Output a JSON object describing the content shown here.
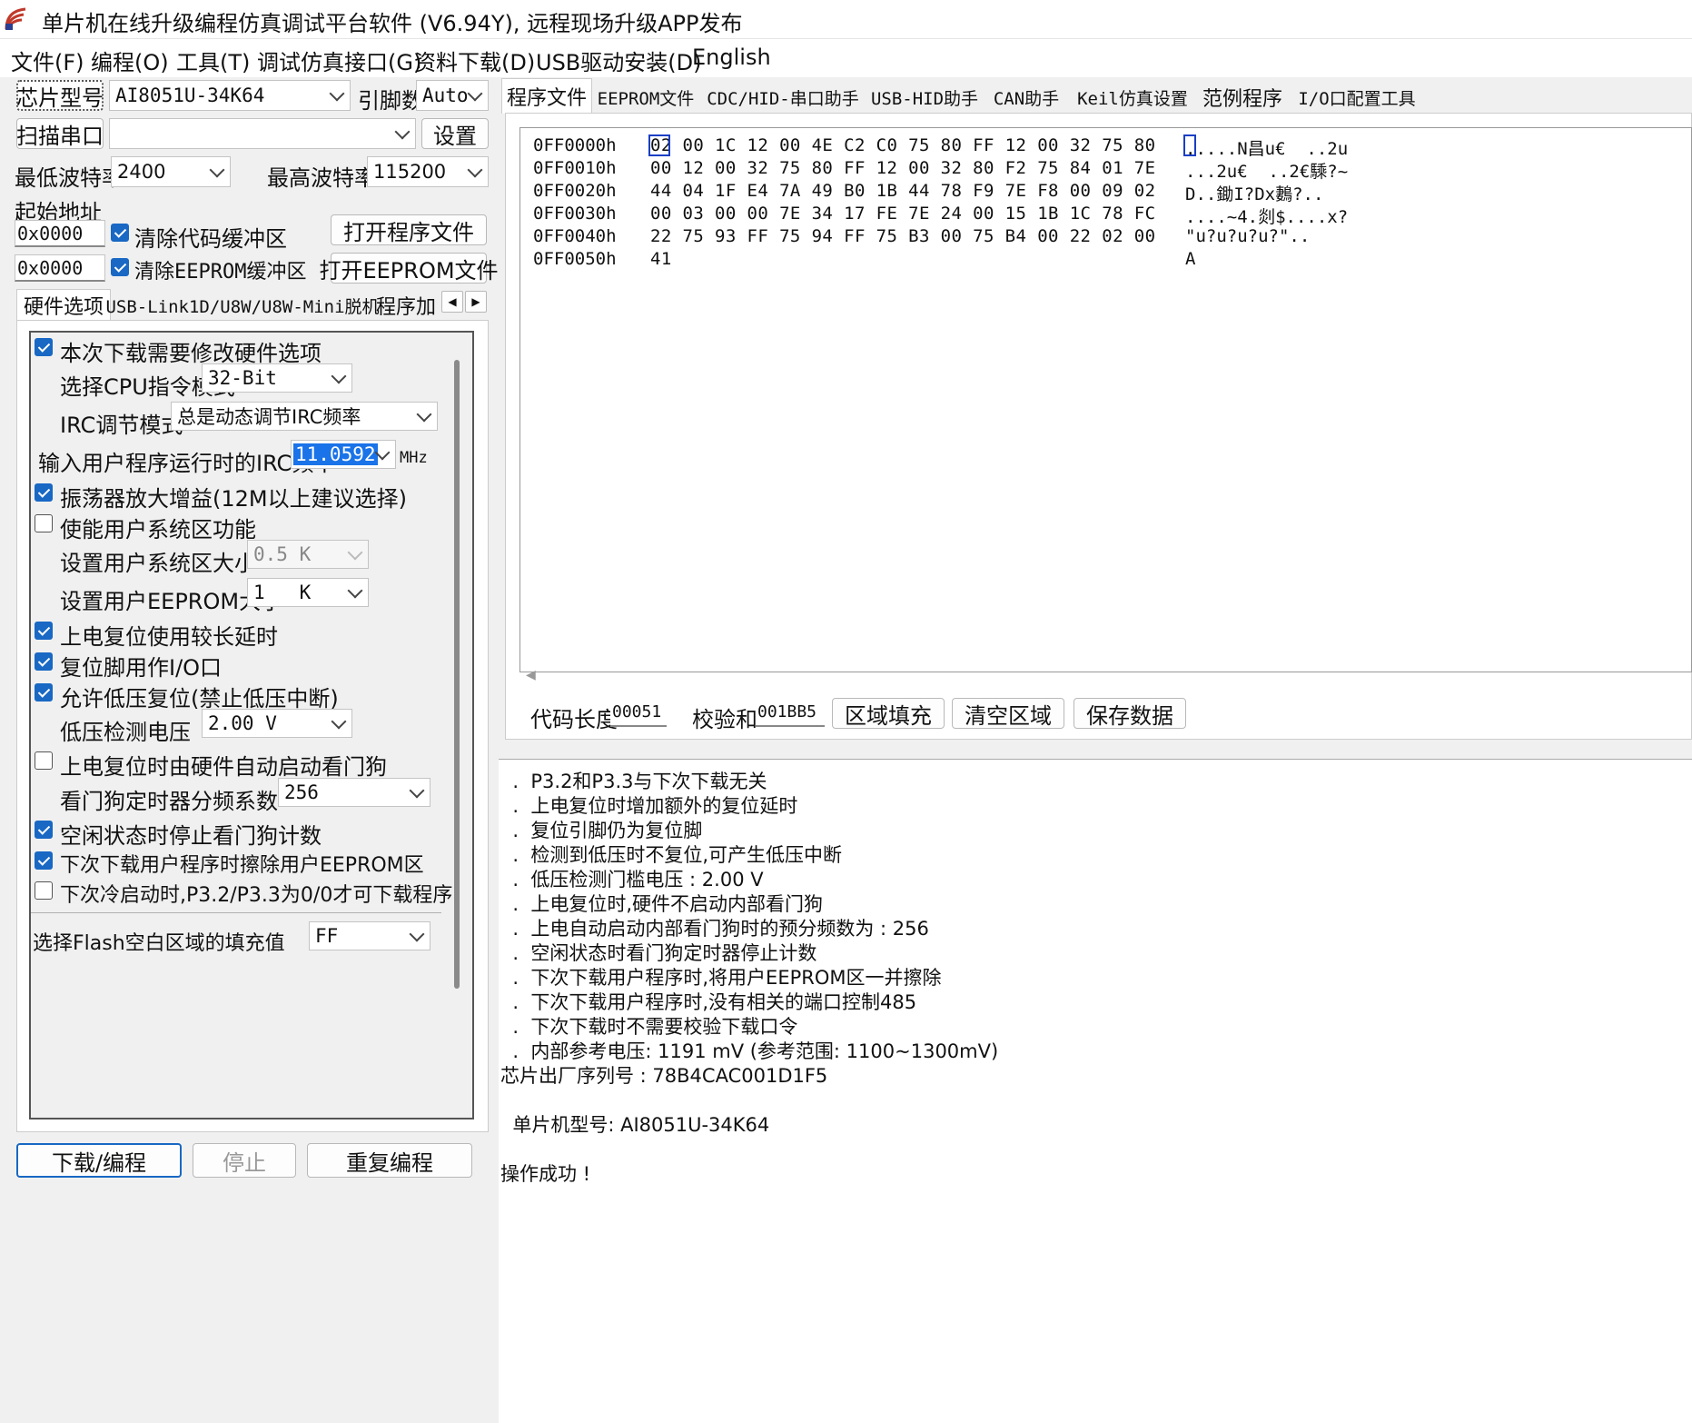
{
  "window": {
    "title": "单片机在线升级编程仿真调试平台软件 (V6.94Y), 远程现场升级APP发布"
  },
  "menu": [
    "文件(F)",
    "编程(O)",
    "工具(T)",
    "调试仿真接口(G)",
    "资料下载(D)",
    "USB驱动安装(D)",
    "English"
  ],
  "left": {
    "chip_model_button": "芯片型号",
    "chip_model_value": "AI8051U-34K64",
    "pin_count_label": "引脚数",
    "pin_count_value": "Auto",
    "scan_port_button": "扫描串口",
    "port_value": "",
    "settings_button": "设置",
    "min_baud_label": "最低波特率",
    "min_baud_value": "2400",
    "max_baud_label": "最高波特率",
    "max_baud_value": "115200",
    "start_addr_label": "起始地址",
    "code_addr": "0x0000",
    "clear_code_label": "清除代码缓冲区",
    "open_program_button": "打开程序文件",
    "eeprom_addr": "0x0000",
    "clear_eeprom_label": "清除EEPROM缓冲区",
    "open_eeprom_button": "打开EEPROM文件",
    "tabs": [
      "硬件选项",
      "USB-Link1D/U8W/U8W-Mini脱机",
      "程序加"
    ],
    "options": {
      "modify_hw": "本次下载需要修改硬件选项",
      "cpu_mode_label": "选择CPU指令模式",
      "cpu_mode_value": "32-Bit",
      "irc_mode_label": "IRC调节模式",
      "irc_mode_value": "总是动态调节IRC频率",
      "irc_freq_label": "输入用户程序运行时的IRC频率",
      "irc_freq_value": "11.0592",
      "irc_freq_unit": "MHz",
      "osc_gain": "振荡器放大增益(12M以上建议选择)",
      "user_sys_area": "使能用户系统区功能",
      "user_sys_size_label": "设置用户系统区大小",
      "user_sys_size_value": "0.5 K",
      "user_eeprom_size_label": "设置用户EEPROM大小",
      "user_eeprom_size_value": "1   K",
      "long_delay": "上电复位使用较长延时",
      "reset_io": "复位脚用作I/O口",
      "lvd_reset": "允许低压复位(禁止低压中断)",
      "lvd_voltage_label": "低压检测电压",
      "lvd_voltage_value": "2.00 V",
      "hw_wdt": "上电复位时由硬件自动启动看门狗",
      "wdt_div_label": "看门狗定时器分频系数",
      "wdt_div_value": "256",
      "idle_wdt": "空闲状态时停止看门狗计数",
      "erase_eeprom": "下次下载用户程序时擦除用户EEPROM区",
      "cold_boot": "下次冷启动时,P3.2/P3.3为0/0才可下载程序",
      "fill_label": "选择Flash空白区域的填充值",
      "fill_value": "FF"
    },
    "download_button": "下载/编程",
    "stop_button": "停止",
    "reprogram_button": "重复编程"
  },
  "right": {
    "tabs": [
      "程序文件",
      "EEPROM文件",
      "CDC/HID-串口助手",
      "USB-HID助手",
      "CAN助手",
      "Keil仿真设置",
      "范例程序",
      "I/O口配置工具"
    ],
    "hex_rows": [
      {
        "addr": "0FF0000h",
        "bytes": "02 00 1C 12 00 4E C2 C0 75 80 FF 12 00 32 75 80",
        "ascii": ".....N昌u€  ..2u"
      },
      {
        "addr": "0FF0010h",
        "bytes": "00 12 00 32 75 80 FF 12 00 32 80 F2 75 84 01 7E",
        "ascii": "...2u€  ..2€騬?~"
      },
      {
        "addr": "0FF0020h",
        "bytes": "44 04 1F E4 7A 49 B0 1B 44 78 F9 7E F8 00 09 02",
        "ascii": "D..鋤I?Dx鶈?.."
      },
      {
        "addr": "0FF0030h",
        "bytes": "00 03 00 00 7E 34 17 FE 7E 24 00 15 1B 1C 78 FC",
        "ascii": "....~4.剡$....x?"
      },
      {
        "addr": "0FF0040h",
        "bytes": "22 75 93 FF 75 94 FF 75 B3 00 75 B4 00 22 02 00",
        "ascii": "\"u?u?u?u?\".."
      },
      {
        "addr": "0FF0050h",
        "bytes": "41",
        "ascii": "A"
      }
    ],
    "code_len_label": "代码长度",
    "code_len_value": "00051",
    "checksum_label": "校验和",
    "checksum_value": "001BB5",
    "fill_area_button": "区域填充",
    "clear_area_button": "清空区域",
    "save_data_button": "保存数据"
  },
  "log": [
    "  .  P3.2和P3.3与下次下载无关",
    "  .  上电复位时增加额外的复位延时",
    "  .  复位引脚仍为复位脚",
    "  .  检测到低压时不复位,可产生低压中断",
    "  .  低压检测门槛电压 : 2.00 V",
    "  .  上电复位时,硬件不启动内部看门狗",
    "  .  上电自动启动内部看门狗时的预分频数为 : 256",
    "  .  空闲状态时看门狗定时器停止计数",
    "  .  下次下载用户程序时,将用户EEPROM区一并擦除",
    "  .  下次下载用户程序时,没有相关的端口控制485",
    "  .  下次下载时不需要校验下载口令",
    "  .  内部参考电压: 1191 mV (参考范围: 1100~1300mV)",
    "芯片出厂序列号 : 78B4CAC001D1F5",
    "",
    "  单片机型号: AI8051U-34K64",
    "",
    "操作成功 !"
  ],
  "colors": {
    "accent": "#1868c4",
    "select_bg": "#1a73e8"
  }
}
